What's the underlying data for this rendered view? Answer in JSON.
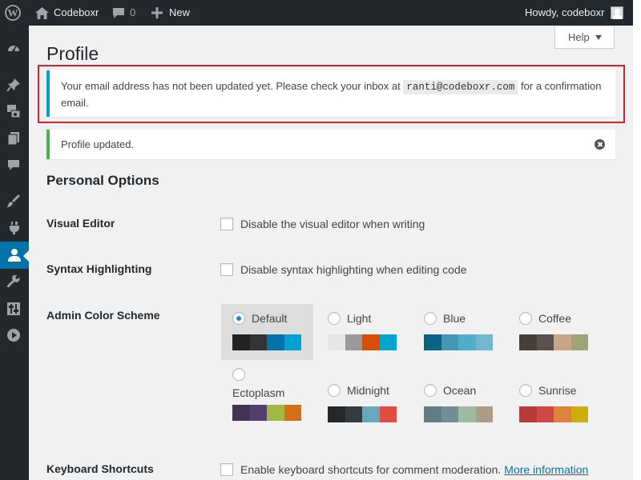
{
  "adminbar": {
    "site_name": "Codeboxr",
    "comment_count": "0",
    "new_label": "New",
    "howdy": "Howdy, codeboxr"
  },
  "sidebar": {
    "items": [
      "dashboard-icon",
      "posts-icon",
      "media-icon",
      "pages-icon",
      "comments-icon",
      "appearance-icon",
      "plugins-icon",
      "users-icon",
      "tools-icon",
      "settings-icon",
      "media-player-icon"
    ],
    "current": "users-icon",
    "accent": "#0073aa"
  },
  "help_tab": {
    "label": "Help"
  },
  "page_title": "Profile",
  "notice_email": {
    "text_before": "Your email address has not been updated yet. Please check your inbox at",
    "email": "ranti@codeboxr.com",
    "text_after": "for a confirmation email.",
    "border_color": "#00a0d2"
  },
  "highlight_color": "#d0242b",
  "notice_success": {
    "text": "Profile updated.",
    "border_color": "#46b450"
  },
  "personal_options": {
    "title": "Personal Options",
    "visual_editor": {
      "label": "Visual Editor",
      "checkbox_label": "Disable the visual editor when writing",
      "checked": false
    },
    "syntax_highlighting": {
      "label": "Syntax Highlighting",
      "checkbox_label": "Disable syntax highlighting when editing code",
      "checked": false
    },
    "admin_color_scheme": {
      "label": "Admin Color Scheme",
      "selected": "Default",
      "schemes": [
        {
          "name": "Default",
          "colors": [
            "#222222",
            "#333333",
            "#0073aa",
            "#00a0d2"
          ]
        },
        {
          "name": "Light",
          "colors": [
            "#e5e5e5",
            "#999999",
            "#d64e07",
            "#04a4cc"
          ]
        },
        {
          "name": "Blue",
          "colors": [
            "#096484",
            "#4796b3",
            "#52accc",
            "#74b6ce"
          ]
        },
        {
          "name": "Coffee",
          "colors": [
            "#46403c",
            "#59524c",
            "#c7a589",
            "#9ea476"
          ]
        },
        {
          "name": "Ectoplasm",
          "colors": [
            "#413256",
            "#523f6d",
            "#a3b745",
            "#d46f15"
          ]
        },
        {
          "name": "Midnight",
          "colors": [
            "#25282b",
            "#363b3f",
            "#69a8bb",
            "#e14d43"
          ]
        },
        {
          "name": "Ocean",
          "colors": [
            "#627c83",
            "#738e96",
            "#9ebaa0",
            "#aa9d88"
          ]
        },
        {
          "name": "Sunrise",
          "colors": [
            "#b43c38",
            "#cf4944",
            "#dd823b",
            "#ccaf0b"
          ]
        }
      ]
    },
    "keyboard_shortcuts": {
      "label": "Keyboard Shortcuts",
      "checkbox_label": "Enable keyboard shortcuts for comment moderation.",
      "link": "More information",
      "checked": false
    }
  }
}
